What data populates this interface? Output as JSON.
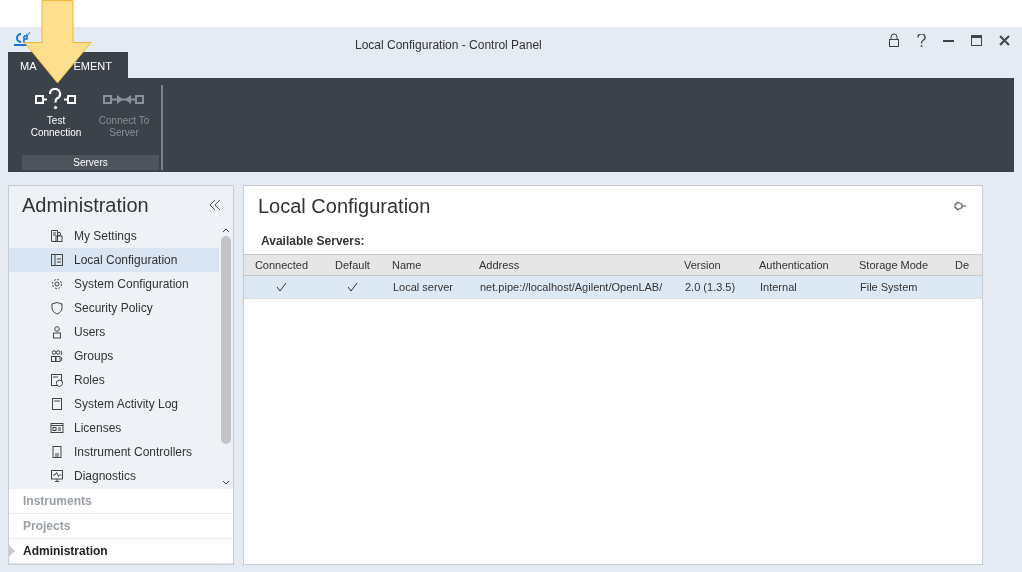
{
  "window": {
    "title": "Local Configuration - Control Panel"
  },
  "ribbon": {
    "tab": {
      "label_start": "MA",
      "label_end": "EMENT",
      "selected": true
    },
    "buttons": [
      {
        "label": "Test Connection",
        "kind": "test",
        "disabled": false
      },
      {
        "label": "Connect To Server",
        "kind": "connect",
        "disabled": true
      }
    ],
    "group": "Servers"
  },
  "sidebar": {
    "title": "Administration",
    "items": [
      {
        "label": "My Settings",
        "selected": false
      },
      {
        "label": "Local Configuration",
        "selected": true
      },
      {
        "label": "System Configuration",
        "selected": false
      },
      {
        "label": "Security Policy",
        "selected": false
      },
      {
        "label": "Users",
        "selected": false
      },
      {
        "label": "Groups",
        "selected": false
      },
      {
        "label": "Roles",
        "selected": false
      },
      {
        "label": "System Activity Log",
        "selected": false
      },
      {
        "label": "Licenses",
        "selected": false
      },
      {
        "label": "Instrument Controllers",
        "selected": false
      },
      {
        "label": "Diagnostics",
        "selected": false
      }
    ],
    "sections": [
      {
        "label": "Instruments",
        "selected": false
      },
      {
        "label": "Projects",
        "selected": false
      },
      {
        "label": "Administration",
        "selected": true
      }
    ]
  },
  "content": {
    "title": "Local Configuration",
    "subtitle": "Available Servers:",
    "table": {
      "columns": [
        "Connected",
        "Default",
        "Name",
        "Address",
        "Version",
        "Authentication",
        "Storage Mode",
        "De"
      ],
      "rows": [
        {
          "selected": true,
          "connected": true,
          "default": true,
          "cells": [
            "",
            "",
            "Local server",
            "net.pipe://localhost/Agilent/OpenLAB/",
            "2.0 (1.3.5)",
            "Internal",
            "File System"
          ]
        }
      ]
    }
  }
}
